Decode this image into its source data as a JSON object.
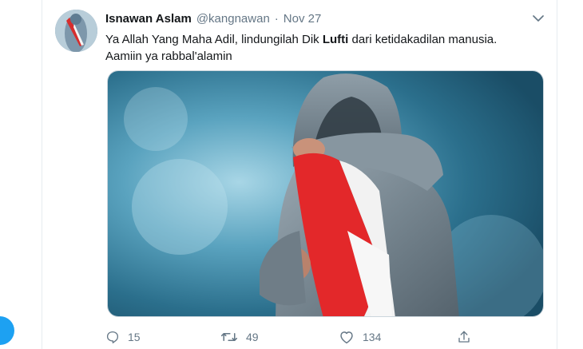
{
  "tweet": {
    "author": {
      "display_name": "Isnawan Aslam",
      "handle": "@kangnawan"
    },
    "separator": "·",
    "timestamp": "Nov 27",
    "text": {
      "line1_before": "Ya Allah Yang Maha Adil,  lindungilah Dik ",
      "line1_bold": "Lufti",
      "line1_after": " dari ketidakadilan manusia.",
      "line2": "Aamiin ya rabbal'alamin"
    },
    "actions": {
      "reply_count": "15",
      "retweet_count": "49",
      "like_count": "134"
    }
  },
  "icons": {
    "menu": "chevron-down-icon",
    "reply": "reply-icon",
    "retweet": "retweet-icon",
    "like": "heart-icon",
    "share": "share-icon"
  },
  "colors": {
    "brand_blue": "#1da1f2",
    "secondary_text": "#657786",
    "primary_text": "#14171a",
    "flag_red": "#e3282a",
    "flag_white": "#f7f7f7"
  }
}
